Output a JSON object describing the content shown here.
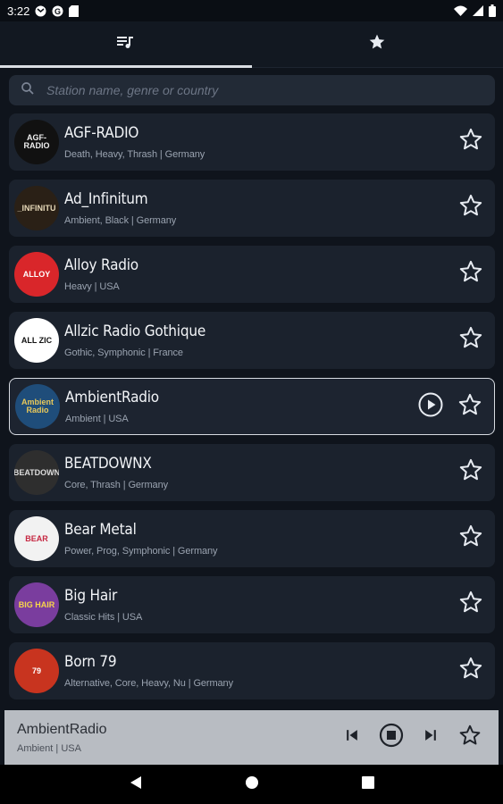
{
  "status_bar": {
    "time": "3:22",
    "icons": [
      "gmail-icon",
      "google-icon",
      "sd-card-icon",
      "wifi-icon",
      "signal-icon",
      "battery-icon"
    ]
  },
  "tabs": [
    {
      "name": "stations",
      "icon": "music-list-icon",
      "active": true
    },
    {
      "name": "favorites",
      "icon": "star-filled-icon",
      "active": false
    }
  ],
  "search": {
    "placeholder": "Station name, genre or country",
    "value": ""
  },
  "stations": [
    {
      "name": "AGF-RADIO",
      "meta": "Death, Heavy, Thrash | Germany",
      "logo_text": "AGF-RADIO",
      "logo_bg": "#111111",
      "logo_fg": "#f0f0f0"
    },
    {
      "name": "Ad_Infinitum",
      "meta": "Ambient, Black | Germany",
      "logo_text": "_INFINITU",
      "logo_bg": "#2a2016",
      "logo_fg": "#e6d8b8"
    },
    {
      "name": "Alloy Radio",
      "meta": "Heavy | USA",
      "logo_text": "ALLOY",
      "logo_bg": "#d9262a",
      "logo_fg": "#ffffff"
    },
    {
      "name": "Allzic Radio Gothique",
      "meta": "Gothic, Symphonic | France",
      "logo_text": "ALL ZIC",
      "logo_bg": "#ffffff",
      "logo_fg": "#111111"
    },
    {
      "name": "AmbientRadio",
      "meta": "Ambient | USA",
      "logo_text": "Ambient Radio",
      "logo_bg": "#1f4d7a",
      "logo_fg": "#e8c85a",
      "selected": true
    },
    {
      "name": "BEATDOWNX",
      "meta": "Core, Thrash | Germany",
      "logo_text": "BEATDOWN",
      "logo_bg": "#2e2e2e",
      "logo_fg": "#dddddd"
    },
    {
      "name": "Bear Metal",
      "meta": "Power, Prog, Symphonic | Germany",
      "logo_text": "BEAR",
      "logo_bg": "#f2f2f2",
      "logo_fg": "#c62842"
    },
    {
      "name": "Big Hair",
      "meta": "Classic Hits | USA",
      "logo_text": "BIG HAIR",
      "logo_bg": "#7a3d9e",
      "logo_fg": "#f7d54a"
    },
    {
      "name": "Born 79",
      "meta": "Alternative, Core, Heavy, Nu | Germany",
      "logo_text": "79",
      "logo_bg": "#c8341f",
      "logo_fg": "#ffffff"
    }
  ],
  "player": {
    "name": "AmbientRadio",
    "meta": "Ambient | USA"
  },
  "colors": {
    "background": "#0f141c",
    "card": "#1b222d",
    "search": "#222a36",
    "player": "#b8bcc2",
    "accent": "#d9dde3"
  }
}
